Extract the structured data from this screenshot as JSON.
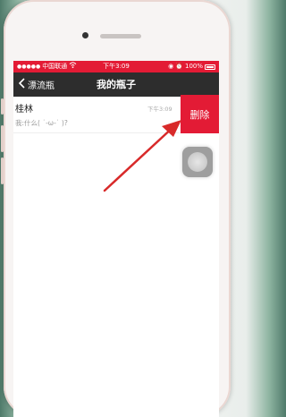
{
  "status_bar": {
    "carrier": "中国联通",
    "time": "下午3:09",
    "battery": "100%"
  },
  "nav": {
    "back_label": "漂流瓶",
    "title": "我的瓶子"
  },
  "conversation": {
    "name": "桂林",
    "time": "下午3:09",
    "preview": "我:什么( ˙-ω-˙ )?",
    "delete_label": "删除"
  },
  "colors": {
    "accent_red": "#e31b35",
    "nav_bg": "#2d2d2d",
    "annotation_arrow": "#d82a2a"
  },
  "icons": [
    "signal-icon",
    "wifi-icon",
    "battery-icon",
    "back-chevron-icon",
    "assistive-touch-icon"
  ]
}
